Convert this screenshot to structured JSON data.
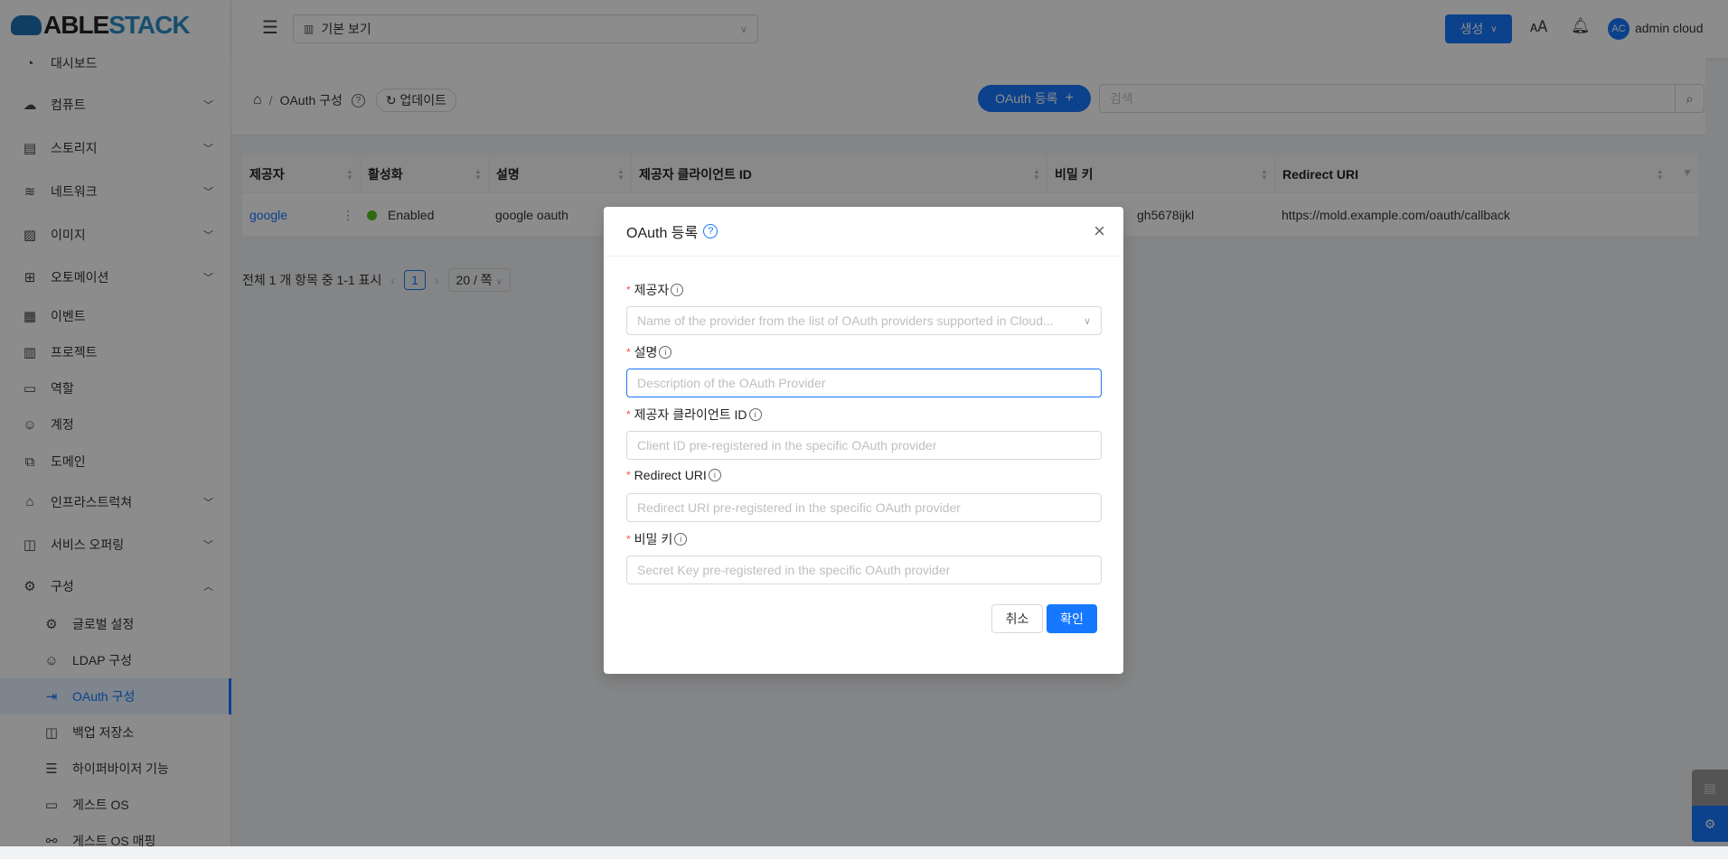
{
  "app": {
    "logo_a": "ABLE",
    "logo_b": "STACK"
  },
  "header": {
    "view_select": "기본 보기",
    "create_label": "생성",
    "user_initials": "AC",
    "user_name": "admin cloud"
  },
  "sidebar": {
    "items": [
      {
        "label": "대시보드",
        "icon": "dashboard-icon"
      },
      {
        "label": "컴퓨트",
        "icon": "cloud-icon",
        "chevron": "down"
      },
      {
        "label": "스토리지",
        "icon": "storage-icon",
        "chevron": "down"
      },
      {
        "label": "네트워크",
        "icon": "wifi-icon",
        "chevron": "down"
      },
      {
        "label": "이미지",
        "icon": "image-icon",
        "chevron": "down"
      },
      {
        "label": "오토메이션",
        "icon": "automation-icon",
        "chevron": "down"
      },
      {
        "label": "이벤트",
        "icon": "calendar-icon"
      },
      {
        "label": "프로젝트",
        "icon": "project-icon"
      },
      {
        "label": "역할",
        "icon": "idcard-icon"
      },
      {
        "label": "계정",
        "icon": "user-icon"
      },
      {
        "label": "도메인",
        "icon": "block-icon"
      },
      {
        "label": "인프라스트럭쳐",
        "icon": "bank-icon",
        "chevron": "down"
      },
      {
        "label": "서비스 오퍼링",
        "icon": "shopping-icon",
        "chevron": "down"
      },
      {
        "label": "구성",
        "icon": "setting-icon",
        "chevron": "up"
      },
      {
        "label": "글로벌 설정",
        "icon": "setting-icon",
        "sub": true
      },
      {
        "label": "LDAP 구성",
        "icon": "team-icon",
        "sub": true
      },
      {
        "label": "OAuth 구성",
        "icon": "login-icon",
        "sub": true,
        "active": true
      },
      {
        "label": "백업 저장소",
        "icon": "inbox-icon",
        "sub": true
      },
      {
        "label": "하이퍼바이저 기능",
        "icon": "database-icon",
        "sub": true
      },
      {
        "label": "게스트 OS",
        "icon": "laptop-icon",
        "sub": true
      },
      {
        "label": "게스트 OS 매핑",
        "icon": "api-icon",
        "sub": true
      }
    ]
  },
  "breadcrumb": {
    "current": "OAuth 구성",
    "refresh_label": "업데이트",
    "add_label": "OAuth 등록",
    "search_placeholder": "검색"
  },
  "table": {
    "columns": [
      "제공자",
      "활성화",
      "설명",
      "제공자 클라이언트 ID",
      "비밀 키",
      "Redirect URI"
    ],
    "rows": [
      {
        "provider": "google",
        "enabled": "Enabled",
        "description": "google oauth",
        "secret": "gh5678ijkl",
        "redirect": "https://mold.example.com/oauth/callback"
      }
    ]
  },
  "pagination": {
    "summary": "전체 1 개 항목 중 1-1 표시",
    "page": "1",
    "page_size": "20 / 쪽"
  },
  "dialog": {
    "title": "OAuth 등록",
    "fields": [
      {
        "label": "제공자",
        "placeholder": "Name of the provider from the list of OAuth providers supported in Cloud..."
      },
      {
        "label": "설명",
        "placeholder": "Description of the OAuth Provider"
      },
      {
        "label": "제공자 클라이언트 ID",
        "placeholder": "Client ID pre-registered in the specific OAuth provider"
      },
      {
        "label": "Redirect URI",
        "placeholder": "Redirect URI pre-registered in the specific OAuth provider"
      },
      {
        "label": "비밀 키",
        "placeholder": "Secret Key pre-registered in the specific OAuth provider"
      }
    ],
    "cancel": "취소",
    "ok": "확인"
  },
  "colors": {
    "primary": "#1677ff",
    "enabled": "#52c41a"
  }
}
